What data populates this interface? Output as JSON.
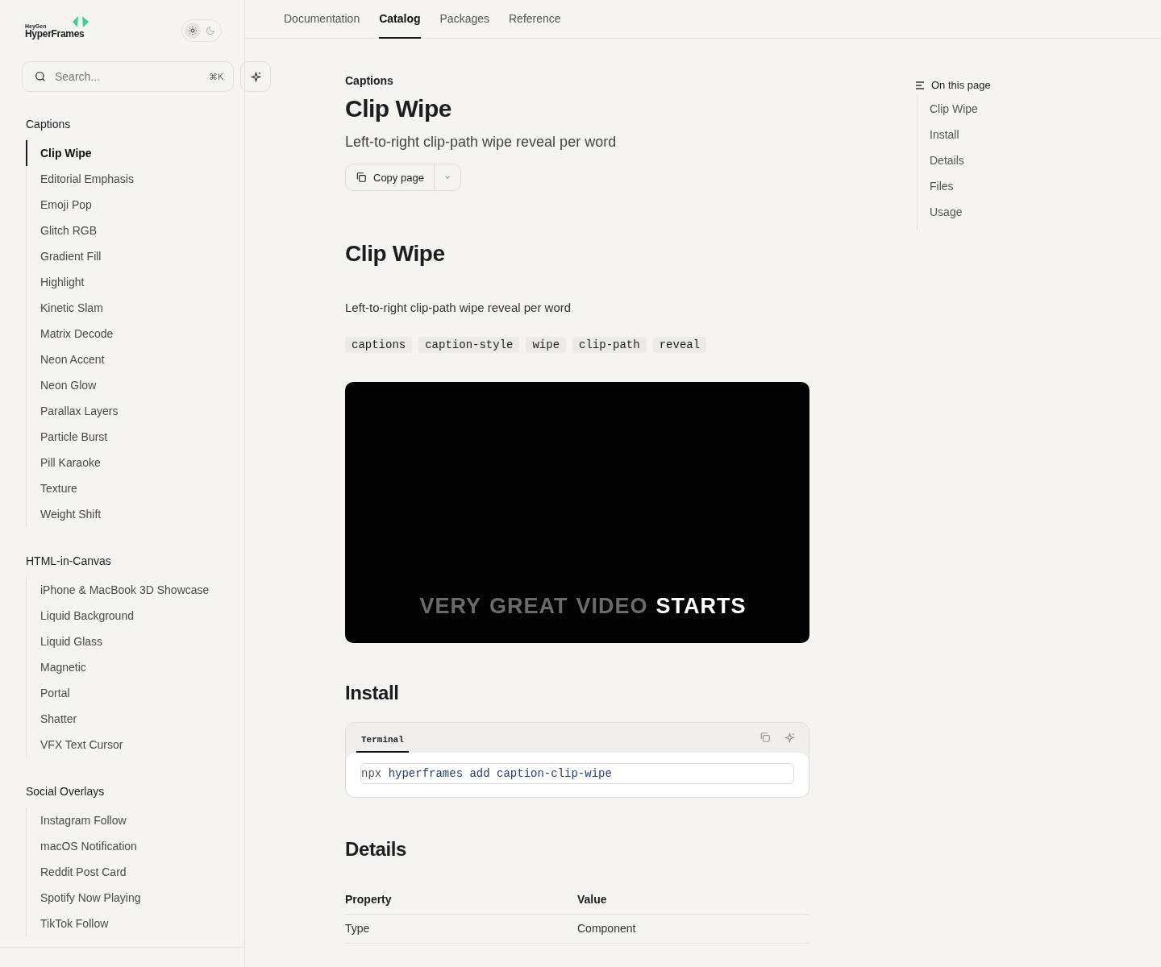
{
  "brand": {
    "small": "HeyGen",
    "name": "HyperFrames"
  },
  "theme_toggle": [
    {
      "kind": "sun",
      "selected": true
    },
    {
      "kind": "moon",
      "selected": false
    }
  ],
  "search": {
    "placeholder": "Search...",
    "shortcut": "⌘K"
  },
  "sidebar": {
    "groups": [
      {
        "title": "Captions",
        "items": [
          {
            "label": "Clip Wipe",
            "selected": true
          },
          {
            "label": "Editorial Emphasis",
            "selected": false
          },
          {
            "label": "Emoji Pop",
            "selected": false
          },
          {
            "label": "Glitch RGB",
            "selected": false
          },
          {
            "label": "Gradient Fill",
            "selected": false
          },
          {
            "label": "Highlight",
            "selected": false
          },
          {
            "label": "Kinetic Slam",
            "selected": false
          },
          {
            "label": "Matrix Decode",
            "selected": false
          },
          {
            "label": "Neon Accent",
            "selected": false
          },
          {
            "label": "Neon Glow",
            "selected": false
          },
          {
            "label": "Parallax Layers",
            "selected": false
          },
          {
            "label": "Particle Burst",
            "selected": false
          },
          {
            "label": "Pill Karaoke",
            "selected": false
          },
          {
            "label": "Texture",
            "selected": false
          },
          {
            "label": "Weight Shift",
            "selected": false
          }
        ]
      },
      {
        "title": "HTML-in-Canvas",
        "items": [
          {
            "label": "iPhone & MacBook 3D Showcase",
            "selected": false
          },
          {
            "label": "Liquid Background",
            "selected": false
          },
          {
            "label": "Liquid Glass",
            "selected": false
          },
          {
            "label": "Magnetic",
            "selected": false
          },
          {
            "label": "Portal",
            "selected": false
          },
          {
            "label": "Shatter",
            "selected": false
          },
          {
            "label": "VFX Text Cursor",
            "selected": false
          }
        ]
      },
      {
        "title": "Social Overlays",
        "items": [
          {
            "label": "Instagram Follow",
            "selected": false
          },
          {
            "label": "macOS Notification",
            "selected": false
          },
          {
            "label": "Reddit Post Card",
            "selected": false
          },
          {
            "label": "Spotify Now Playing",
            "selected": false
          },
          {
            "label": "TikTok Follow",
            "selected": false
          }
        ]
      }
    ]
  },
  "tabs": [
    {
      "label": "Documentation",
      "selected": false
    },
    {
      "label": "Catalog",
      "selected": true
    },
    {
      "label": "Packages",
      "selected": false
    },
    {
      "label": "Reference",
      "selected": false
    }
  ],
  "page": {
    "eyebrow": "Captions",
    "title": "Clip Wipe",
    "subtitle": "Left-to-right clip-path wipe reveal per word",
    "copy_button": "Copy page",
    "section_title": "Clip Wipe",
    "description": "Left-to-right clip-path wipe reveal per word",
    "tags": [
      "captions",
      "caption-style",
      "wipe",
      "clip-path",
      "reveal"
    ],
    "preview_caption": [
      {
        "word": "VERY",
        "revealed": false
      },
      {
        "word": "GREAT",
        "revealed": false
      },
      {
        "word": "VIDEO",
        "revealed": false
      },
      {
        "word": "STARTS",
        "revealed": true
      }
    ],
    "install": {
      "title": "Install",
      "tab": "Terminal",
      "command": [
        {
          "kind": "plain",
          "text": "npx"
        },
        {
          "kind": "accent",
          "text": "hyperframes add caption-clip-wipe"
        }
      ]
    },
    "details": {
      "title": "Details",
      "columns": [
        "Property",
        "Value"
      ],
      "rows": [
        [
          "Type",
          "Component"
        ]
      ]
    }
  },
  "toc": {
    "title": "On this page",
    "items": [
      "Clip Wipe",
      "Install",
      "Details",
      "Files",
      "Usage"
    ]
  }
}
